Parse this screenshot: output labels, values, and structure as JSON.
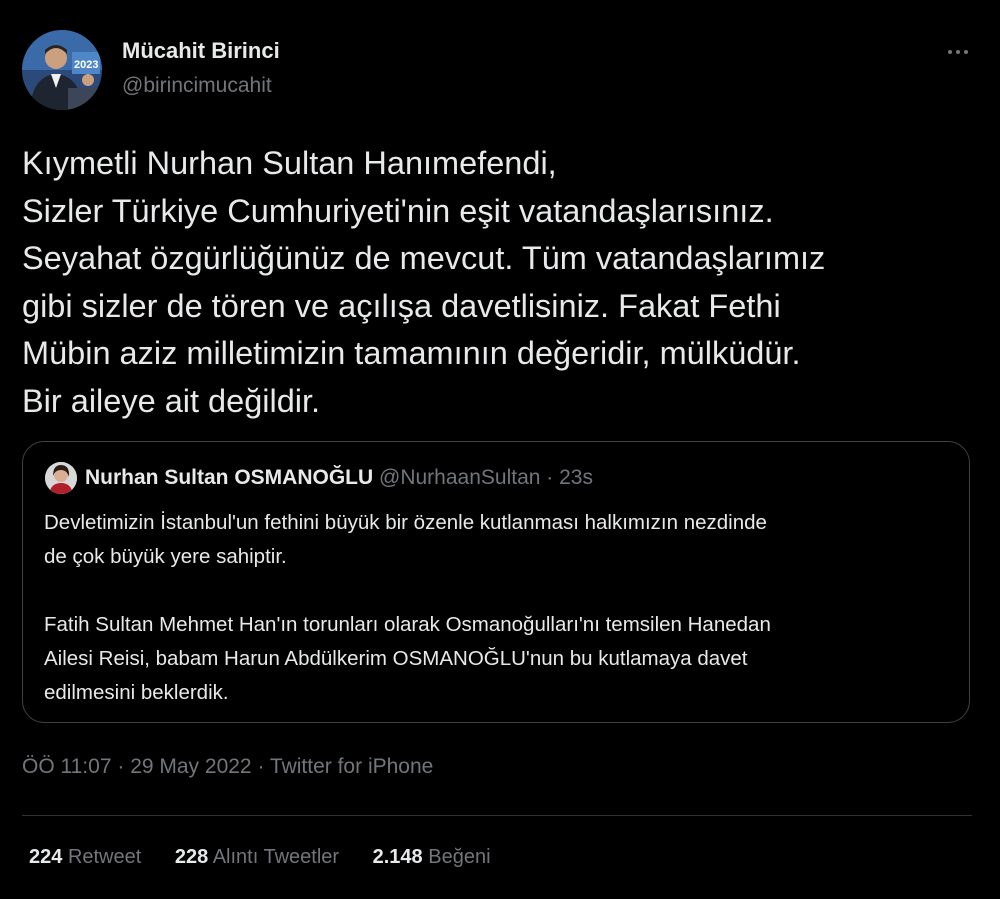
{
  "author": {
    "name": "Mücahit Birinci",
    "handle": "@birincimucahit",
    "avatar_icon": "profile-photo",
    "avatar_badge_text": "2023"
  },
  "tweet": {
    "lines": [
      "Kıymetli Nurhan Sultan Hanımefendi,",
      "Sizler Türkiye Cumhuriyeti'nin eşit vatandaşlarısınız.",
      "Seyahat özgürlüğünüz de mevcut. Tüm vatandaşlarımız",
      "gibi sizler de tören ve açılışa davetlisiniz. Fakat Fethi",
      "Mübin aziz milletimizin tamamının değeridir, mülküdür.",
      "Bir aileye ait değildir."
    ]
  },
  "quote": {
    "name": "Nurhan Sultan OSMANOĞLU",
    "handle": "@NurhaanSultan",
    "separator": "·",
    "time": "23s",
    "lines": [
      "Devletimizin İstanbul'un fethini büyük bir özenle kutlanması halkımızın nezdinde",
      "de çok büyük yere sahiptir."
    ],
    "lines2": [
      "Fatih Sultan Mehmet Han'ın torunları olarak Osmanoğulları'nı temsilen Hanedan",
      "Ailesi Reisi, babam Harun Abdülkerim OSMANOĞLU'nun bu kutlamaya davet",
      "edilmesini beklerdik."
    ]
  },
  "meta": {
    "time": "ÖÖ 11:07",
    "separator": "·",
    "date": "29 May 2022",
    "source": "Twitter for iPhone"
  },
  "stats": {
    "retweets_count": "224",
    "retweets_label": "Retweet",
    "quotes_count": "228",
    "quotes_label": "Alıntı Tweetler",
    "likes_count": "2.148",
    "likes_label": "Beğeni"
  },
  "colors": {
    "background": "#000000",
    "text_primary": "#e7e9ea",
    "text_secondary": "#71767b",
    "border": "#3e4144"
  }
}
